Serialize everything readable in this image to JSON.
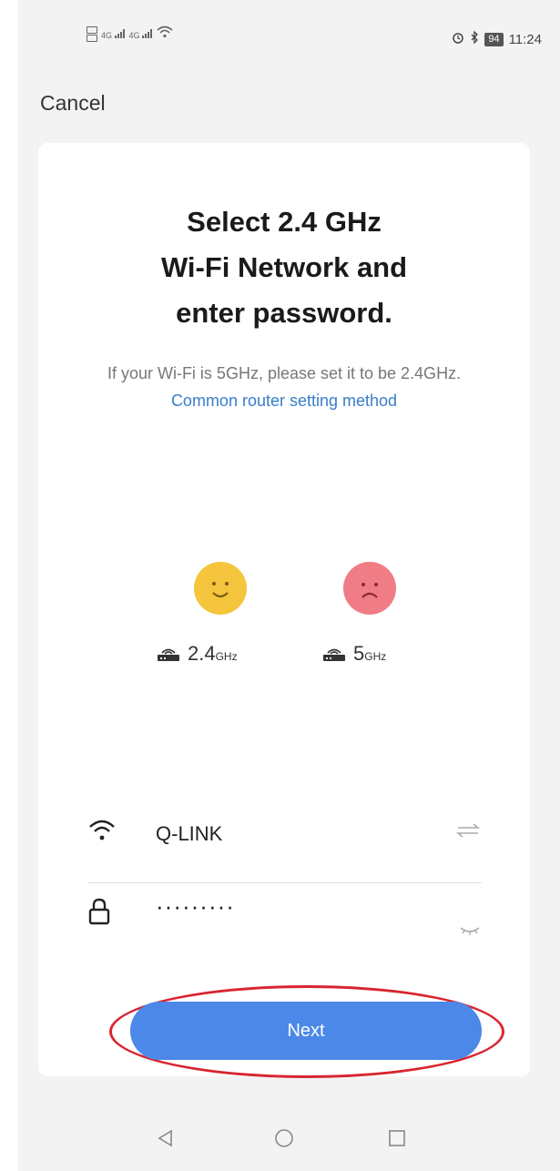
{
  "status_bar": {
    "time": "11:24",
    "battery": "94",
    "signal_1": "4G",
    "signal_2": "4G"
  },
  "header": {
    "cancel_label": "Cancel"
  },
  "card": {
    "title_line1": "Select 2.4 GHz",
    "title_line2": "Wi-Fi Network and",
    "title_line3": "enter password.",
    "subtitle_text": "If your Wi-Fi is 5GHz, please set it to be 2.4GHz.",
    "subtitle_link": "Common router setting method",
    "band_good_num": "2.4",
    "band_good_unit": "GHz",
    "band_bad_num": "5",
    "band_bad_unit": "GHz"
  },
  "form": {
    "ssid_value": "Q-LINK",
    "password_value": "·········"
  },
  "actions": {
    "next_label": "Next"
  },
  "colors": {
    "accent": "#4c88e8",
    "link": "#3a7dc9",
    "happy_face": "#f4c53d",
    "sad_face": "#f07c86",
    "highlight_ring": "#d8252f"
  },
  "icons": [
    "wifi-icon",
    "lock-icon",
    "switch-network-icon",
    "eye-closed-icon",
    "router-icon",
    "back-icon",
    "home-icon",
    "recent-apps-icon"
  ]
}
